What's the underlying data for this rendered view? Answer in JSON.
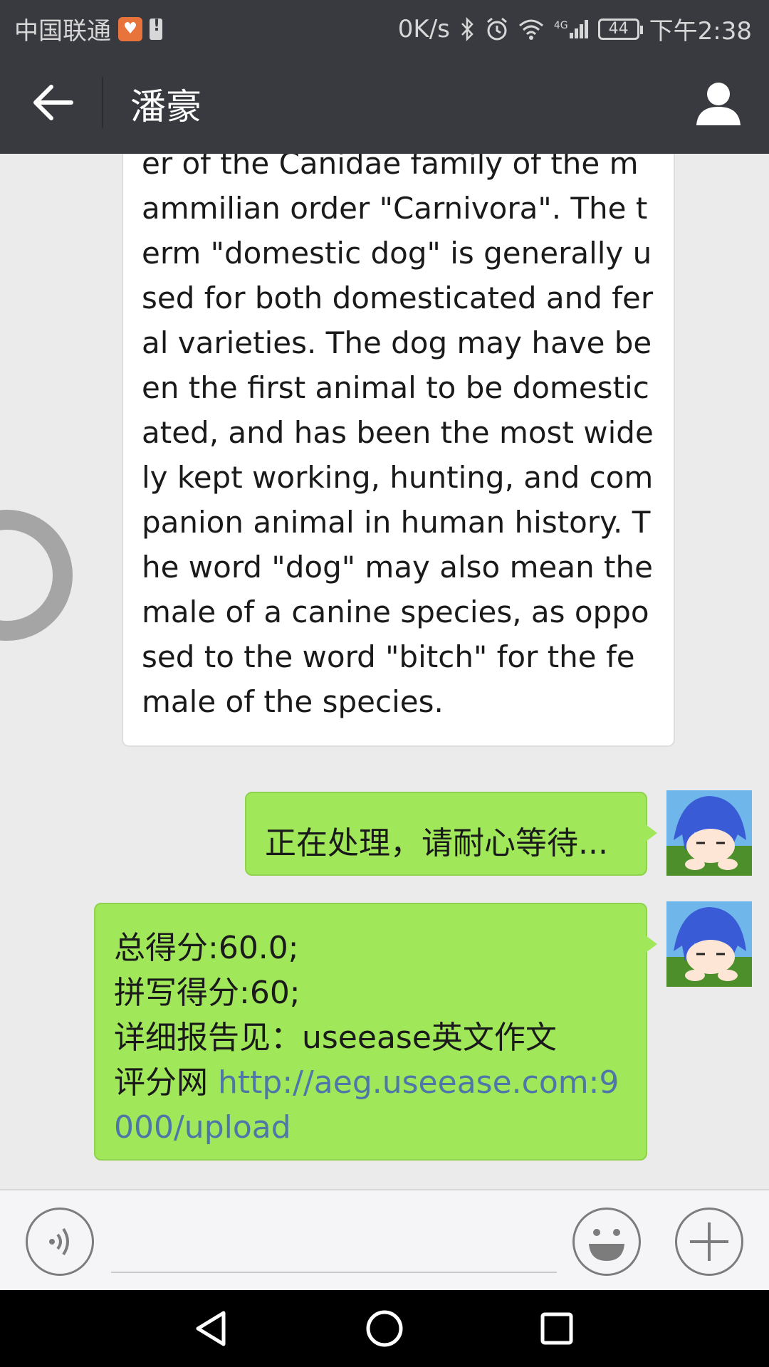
{
  "status_bar": {
    "carrier": "中国联通",
    "speed": "0K/s",
    "network": "4G",
    "battery": "44",
    "time": "下午2:38",
    "icons": [
      "health-app-icon",
      "clipboard-alert-icon",
      "bluetooth-icon",
      "alarm-icon",
      "wifi-icon",
      "signal-icon",
      "battery-icon"
    ]
  },
  "header": {
    "title": "潘豪",
    "back_icon": "arrow-left-icon",
    "profile_icon": "person-icon"
  },
  "messages": {
    "incoming_text": "er of the Canidae family of the mammilian order \"Carnivora\". The term \"domestic dog\" is generally used for both domesticated and feral varieties. The dog may have been the first animal to be domesticated, and has been the most widely kept working, hunting, and companion animal in human history. The word \"dog\" may also mean the male of a canine species, as opposed to the word \"bitch\" for the female of the species.",
    "processing": "正在处理，请耐心等待...",
    "result": {
      "total": "总得分:60.0;",
      "spelling": "拼写得分:60;",
      "report_prefix": "详细报告见：useease英文作文",
      "report_site": "评分网 ",
      "link": "http://aeg.useease.com:9000/upload"
    }
  },
  "input_bar": {
    "voice_icon": "voice-icon",
    "emoji_icon": "emoji-icon",
    "plus_icon": "plus-icon"
  },
  "nav_bar": {
    "icons": [
      "back-triangle-icon",
      "home-circle-icon",
      "recent-square-icon"
    ]
  },
  "colors": {
    "header_bg": "#393a3f",
    "chat_bg": "#ebebeb",
    "sent_bubble": "#a0e75a",
    "link": "#4e76a8"
  }
}
